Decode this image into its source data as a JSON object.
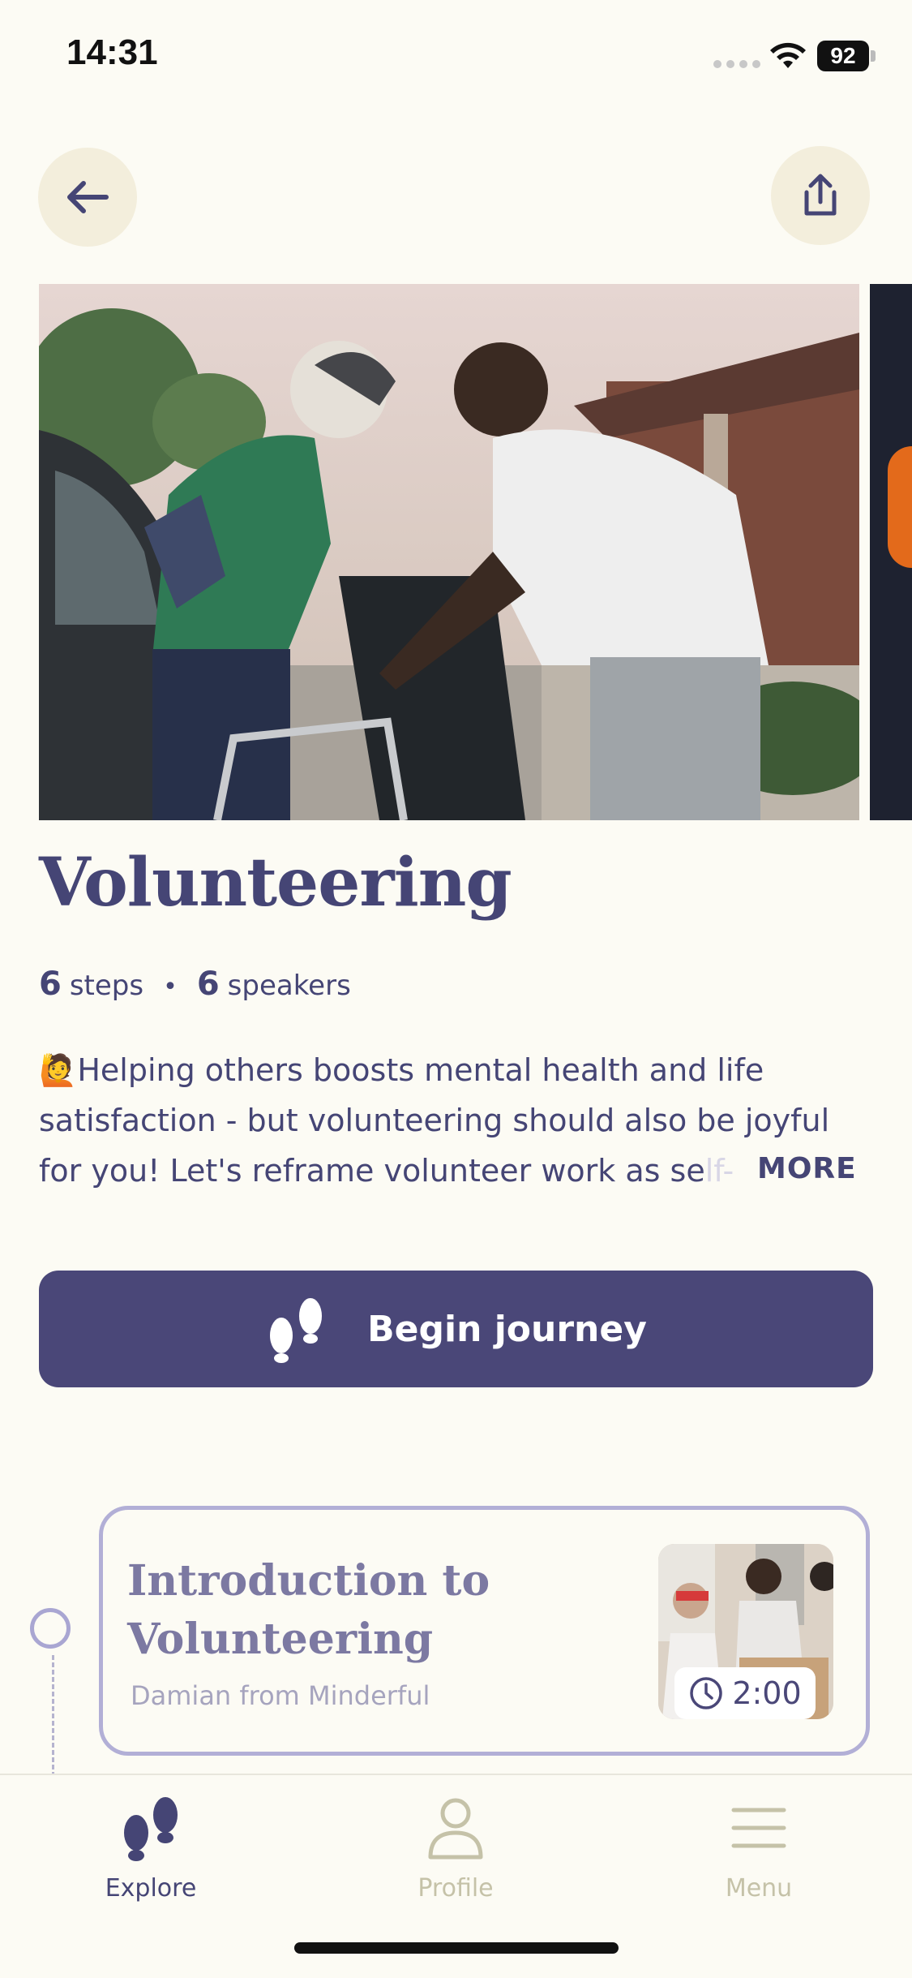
{
  "status_bar": {
    "time": "14:31",
    "battery": "92"
  },
  "header": {
    "back_icon": "arrow-left-icon",
    "share_icon": "share-icon"
  },
  "journey": {
    "title": "Volunteering",
    "steps_count": "6",
    "steps_label": "steps",
    "speakers_count": "6",
    "speakers_label": "speakers",
    "description_emoji": "🙋",
    "description_line1": "Helping others boosts mental health and life",
    "description_line2": "satisfaction - but volunteering should also be joyful",
    "description_line3": "for you! Let's reframe volunteer work as se",
    "description_fade": "lf-",
    "more_label": "MORE",
    "begin_label": "Begin journey"
  },
  "steps": [
    {
      "title": "Introduction to Volunteering",
      "speaker": "Damian from Minderful",
      "duration": "2:00"
    }
  ],
  "tab_bar": {
    "items": [
      {
        "label": "Explore",
        "icon": "footprints-icon",
        "active": true
      },
      {
        "label": "Profile",
        "icon": "person-icon",
        "active": false
      },
      {
        "label": "Menu",
        "icon": "hamburger-icon",
        "active": false
      }
    ]
  },
  "colors": {
    "background": "#FCFBF4",
    "primary": "#4A4778",
    "text": "#454575",
    "muted": "#C5C2A8",
    "accent_soft": "#F3EEDC"
  }
}
